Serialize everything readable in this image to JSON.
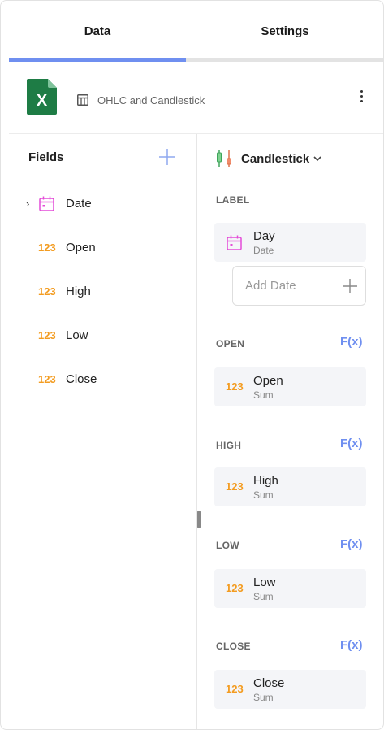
{
  "tabs": [
    {
      "label": "Data",
      "active": true
    },
    {
      "label": "Settings",
      "active": false
    }
  ],
  "source": {
    "icon": "excel-file-icon",
    "name": "OHLC and Candlestick"
  },
  "fields_panel": {
    "title": "Fields",
    "items": [
      {
        "label": "Date",
        "type": "date",
        "icon": "calendar-icon"
      },
      {
        "label": "Open",
        "type": "number",
        "badge": "123"
      },
      {
        "label": "High",
        "type": "number",
        "badge": "123"
      },
      {
        "label": "Low",
        "type": "number",
        "badge": "123"
      },
      {
        "label": "Close",
        "type": "number",
        "badge": "123"
      }
    ]
  },
  "viz": {
    "type_label": "Candlestick",
    "label_section": {
      "title": "LABEL",
      "item": {
        "name": "Day",
        "sub": "Date"
      },
      "add_placeholder": "Add Date"
    },
    "sections": [
      {
        "title": "OPEN",
        "fx": "F(x)",
        "item": {
          "name": "Open",
          "sub": "Sum",
          "badge": "123"
        }
      },
      {
        "title": "HIGH",
        "fx": "F(x)",
        "item": {
          "name": "High",
          "sub": "Sum",
          "badge": "123"
        }
      },
      {
        "title": "LOW",
        "fx": "F(x)",
        "item": {
          "name": "Low",
          "sub": "Sum",
          "badge": "123"
        }
      },
      {
        "title": "CLOSE",
        "fx": "F(x)",
        "item": {
          "name": "Close",
          "sub": "Sum",
          "badge": "123"
        }
      }
    ]
  },
  "colors": {
    "accent": "#6f8ff0",
    "number_badge": "#f39c21",
    "date_icon": "#e44cd8",
    "excel_green": "#1e7c45"
  }
}
